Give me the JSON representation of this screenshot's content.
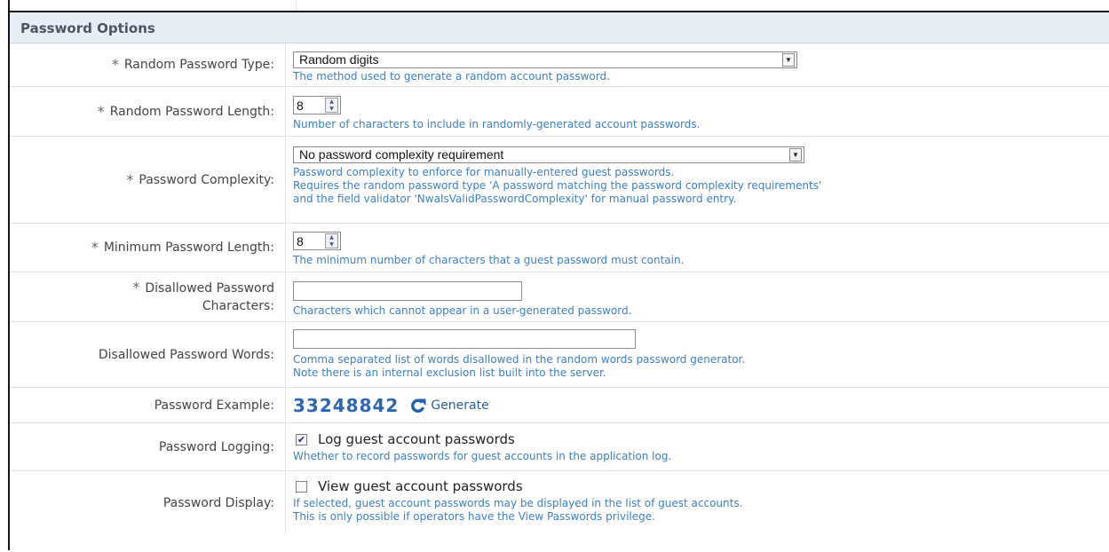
{
  "section_title": "Password Options",
  "rows": {
    "random_type": {
      "label": "Random Password Type:",
      "value": "Random digits",
      "desc": "The method used to generate a random account password."
    },
    "random_length": {
      "label": "Random Password Length:",
      "value": "8",
      "desc": "Number of characters to include in randomly-generated account passwords."
    },
    "complexity": {
      "label": "Password Complexity:",
      "value": "No password complexity requirement",
      "desc": [
        "Password complexity to enforce for manually-entered guest passwords.",
        "Requires the random password type 'A password matching the password complexity requirements'",
        "and the field validator 'NwaIsValidPasswordComplexity' for manual password entry."
      ]
    },
    "min_length": {
      "label": "Minimum Password Length:",
      "value": "8",
      "desc": "The minimum number of characters that a guest password must contain."
    },
    "disallowed_chars": {
      "label_line1": "Disallowed Password",
      "label_line2": "Characters:",
      "value": "",
      "desc": "Characters which cannot appear in a user-generated password."
    },
    "disallowed_words": {
      "label": "Disallowed Password Words:",
      "value": "",
      "desc": [
        "Comma separated list of words disallowed in the random words password generator.",
        "Note there is an internal exclusion list built into the server."
      ]
    },
    "example": {
      "label": "Password Example:",
      "value": "33248842",
      "generate_label": "Generate"
    },
    "logging": {
      "label": "Password Logging:",
      "checkbox_label": "Log guest account passwords",
      "checked": true,
      "desc": "Whether to record passwords for guest accounts in the application log."
    },
    "display": {
      "label": "Password Display:",
      "checkbox_label": "View guest account passwords",
      "checked": false,
      "desc": [
        "If selected, guest account passwords may be displayed in the list of guest accounts.",
        "This is only possible if operators have the View Passwords privilege."
      ]
    }
  },
  "required_marker": "*",
  "colors": {
    "description": "#3f7fbf",
    "password_example": "#2e66b2",
    "header_bg": "#e8eef5"
  },
  "icons": {
    "generate": "refresh-arrow-icon",
    "dropdown": "chevron-down-icon",
    "spinner": "spinner-arrows-icon",
    "checkbox": "checkbox-icon"
  }
}
